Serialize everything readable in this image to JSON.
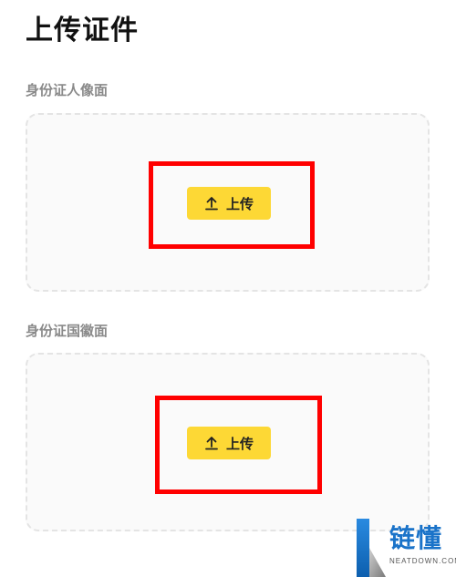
{
  "page": {
    "title": "上传证件"
  },
  "sections": [
    {
      "label": "身份证人像面",
      "upload_label": "上传"
    },
    {
      "label": "身份证国徽面",
      "upload_label": "上传"
    }
  ],
  "icons": {
    "upload": "upload-arrow-icon"
  },
  "colors": {
    "accent": "#fdd835",
    "highlight": "#ff0000",
    "label": "#8a8a8a",
    "title": "#111111",
    "watermark": "#1a73c9"
  },
  "watermark": {
    "cn": "链懂",
    "en": "NEATDOWN.COM"
  }
}
